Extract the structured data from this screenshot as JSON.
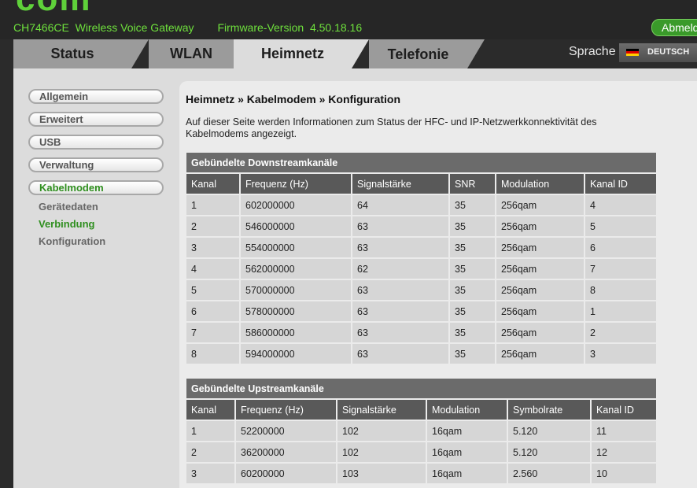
{
  "header": {
    "logo": "com",
    "model": "CH7466CE",
    "product": "Wireless Voice Gateway",
    "firmware_label": "Firmware-Version",
    "firmware_version": "4.50.18.16",
    "logout_label": "Abmeld"
  },
  "tabs": [
    {
      "label": "Status"
    },
    {
      "label": "WLAN"
    },
    {
      "label": "Heimnetz"
    },
    {
      "label": "Telefonie"
    }
  ],
  "language": {
    "label": "Sprache",
    "value": "DEUTSCH",
    "flag_icon": "german-flag-icon"
  },
  "sidebar": {
    "items": [
      {
        "label": "Allgemein"
      },
      {
        "label": "Erweitert"
      },
      {
        "label": "USB"
      },
      {
        "label": "Verwaltung"
      },
      {
        "label": "Kabelmodem"
      }
    ],
    "subitems": [
      {
        "label": "Gerätedaten"
      },
      {
        "label": "Verbindung"
      },
      {
        "label": "Konfiguration"
      }
    ]
  },
  "main": {
    "breadcrumb": "Heimnetz » Kabelmodem » Konfiguration",
    "description": "Auf dieser Seite werden Informationen zum Status der HFC- und IP-Netzwerkkonnektivität des Kabelmodems angezeigt.",
    "downstream": {
      "title": "Gebündelte Downstreamkanäle",
      "columns": [
        "Kanal",
        "Frequenz (Hz)",
        "Signalstärke",
        "SNR",
        "Modulation",
        "Kanal ID"
      ],
      "rows": [
        [
          "1",
          "602000000",
          "64",
          "35",
          "256qam",
          "4"
        ],
        [
          "2",
          "546000000",
          "63",
          "35",
          "256qam",
          "5"
        ],
        [
          "3",
          "554000000",
          "63",
          "35",
          "256qam",
          "6"
        ],
        [
          "4",
          "562000000",
          "62",
          "35",
          "256qam",
          "7"
        ],
        [
          "5",
          "570000000",
          "63",
          "35",
          "256qam",
          "8"
        ],
        [
          "6",
          "578000000",
          "63",
          "35",
          "256qam",
          "1"
        ],
        [
          "7",
          "586000000",
          "63",
          "35",
          "256qam",
          "2"
        ],
        [
          "8",
          "594000000",
          "63",
          "35",
          "256qam",
          "3"
        ]
      ]
    },
    "upstream": {
      "title": "Gebündelte Upstreamkanäle",
      "columns": [
        "Kanal",
        "Frequenz (Hz)",
        "Signalstärke",
        "Modulation",
        "Symbolrate",
        "Kanal ID"
      ],
      "rows": [
        [
          "1",
          "52200000",
          "102",
          "16qam",
          "5.120",
          "11"
        ],
        [
          "2",
          "36200000",
          "102",
          "16qam",
          "5.120",
          "12"
        ],
        [
          "3",
          "60200000",
          "103",
          "16qam",
          "2.560",
          "10"
        ]
      ]
    }
  }
}
